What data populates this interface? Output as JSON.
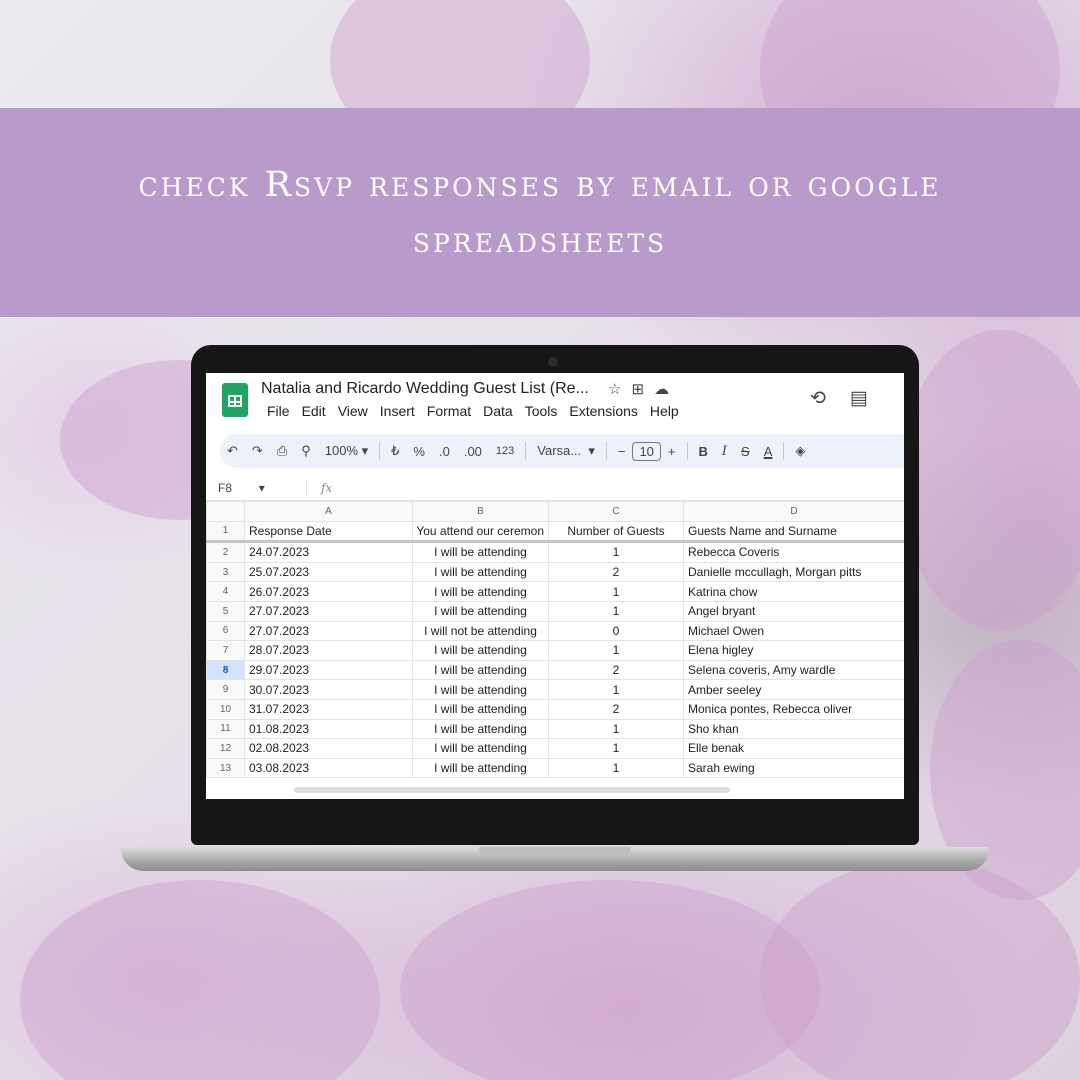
{
  "banner": {
    "title": "check Rsvp responses by email or google spreadsheets"
  },
  "sheets": {
    "doc_title": "Natalia and Ricardo Wedding Guest List (Re...",
    "title_icons": [
      "star-icon",
      "move-to-folder-icon",
      "cloud-status-icon"
    ],
    "menu": [
      "File",
      "Edit",
      "View",
      "Insert",
      "Format",
      "Data",
      "Tools",
      "Extensions",
      "Help"
    ],
    "header_icons": [
      "history-icon",
      "comments-icon"
    ],
    "toolbar": {
      "zoom": "100%",
      "currency": "₺",
      "percent": "%",
      "decrease_decimals": ".0",
      "increase_decimals": ".00",
      "number_format": "123",
      "font": "Varsa...",
      "font_size": "10",
      "bold": "B",
      "italic": "I",
      "strikethrough": "S",
      "text_color": "A"
    },
    "name_box": "F8",
    "fx": "fx",
    "columns": [
      "A",
      "B",
      "C",
      "D"
    ],
    "header_row": {
      "num": "1",
      "cells": [
        "Response Date",
        "ll You attend our ceremon",
        "Number of Guests",
        "Guests Name and Surname"
      ]
    },
    "rows": [
      {
        "num": "2",
        "date": "24.07.2023",
        "attend": "I will be attending",
        "guests": "1",
        "names": "Rebecca Coveris"
      },
      {
        "num": "3",
        "date": "25.07.2023",
        "attend": "I will be attending",
        "guests": "2",
        "names": "Danielle mccullagh, Morgan pitts"
      },
      {
        "num": "4",
        "date": "26.07.2023",
        "attend": "I will be attending",
        "guests": "1",
        "names": "Katrina chow"
      },
      {
        "num": "5",
        "date": "27.07.2023",
        "attend": "I will be attending",
        "guests": "1",
        "names": "Angel bryant"
      },
      {
        "num": "6",
        "date": "27.07.2023",
        "attend": "I will not be attending",
        "guests": "0",
        "names": "Michael Owen"
      },
      {
        "num": "7",
        "date": "28.07.2023",
        "attend": "I will be attending",
        "guests": "1",
        "names": "Elena higley"
      },
      {
        "num": "8",
        "date": "29.07.2023",
        "attend": "I will be attending",
        "guests": "2",
        "names": "Selena coveris, Amy wardle"
      },
      {
        "num": "9",
        "date": "30.07.2023",
        "attend": "I will be attending",
        "guests": "1",
        "names": "Amber seeley"
      },
      {
        "num": "10",
        "date": "31.07.2023",
        "attend": "I will be attending",
        "guests": "2",
        "names": "Monica pontes, Rebecca oliver"
      },
      {
        "num": "11",
        "date": "01.08.2023",
        "attend": "I will be attending",
        "guests": "1",
        "names": "Sho khan"
      },
      {
        "num": "12",
        "date": "02.08.2023",
        "attend": "I will be attending",
        "guests": "1",
        "names": "Elle benak"
      },
      {
        "num": "13",
        "date": "03.08.2023",
        "attend": "I will be attending",
        "guests": "1",
        "names": "Sarah ewing"
      }
    ],
    "selected_row": "8"
  },
  "colors": {
    "banner": "#b89bcb",
    "sheets_green": "#1fa463",
    "toolbar_bg": "#edf2fa"
  }
}
